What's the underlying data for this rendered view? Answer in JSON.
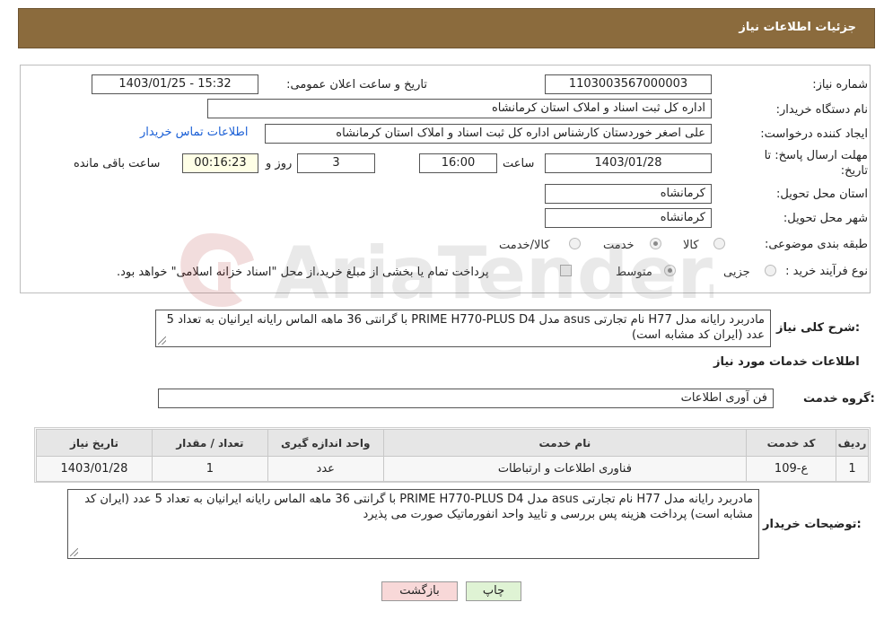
{
  "header": {
    "title": "جزئیات اطلاعات نیاز"
  },
  "form": {
    "need_number_label": "شماره نیاز:",
    "need_number": "1103003567000003",
    "announce_label": "تاریخ و ساعت اعلان عمومی:",
    "announce_value": "1403/01/25 - 15:32",
    "buyer_label": "نام دستگاه خریدار:",
    "buyer_value": "اداره کل ثبت اسناد و املاک استان کرمانشاه",
    "requester_label": "ایجاد کننده درخواست:",
    "requester_value": "علی اصغر خوردستان کارشناس اداره کل ثبت اسناد و املاک استان کرمانشاه",
    "contact_link": "اطلاعات تماس خریدار",
    "deadline_label_1": "مهلت ارسال پاسخ: تا",
    "deadline_label_2": "تاریخ:",
    "deadline_date": "1403/01/28",
    "time_label": "ساعت",
    "deadline_time": "16:00",
    "days_value": "3",
    "days_label": "روز و",
    "remaining_time": "00:16:23",
    "remaining_label": "ساعت باقی مانده",
    "province_label": "استان محل تحویل:",
    "province_value": "کرمانشاه",
    "city_label": "شهر محل تحویل:",
    "city_value": "کرمانشاه",
    "category_label": "طبقه بندی موضوعی:",
    "category_options": [
      "کالا",
      "خدمت",
      "کالا/خدمت"
    ],
    "category_selected_index": 1,
    "process_label": "نوع فرآیند خرید :",
    "process_options": [
      "جزیی",
      "متوسط"
    ],
    "process_selected_index": 1,
    "payment_note": "پرداخت تمام یا بخشی از مبلغ خرید،از محل \"اسناد خزانه اسلامی\" خواهد بود."
  },
  "summary": {
    "label": "شرح کلی نیاز:",
    "text": "مادربرد رایانه مدل H77 نام تجارتی asus مدل PRIME H770-PLUS D4 با گرانتی 36 ماهه الماس رایانه ایرانیان به تعداد 5 عدد (ایران کد مشابه است)"
  },
  "services": {
    "section_title": "اطلاعات خدمات مورد نیاز",
    "group_label": "گروه خدمت:",
    "group_value": "فن آوری اطلاعات",
    "table": {
      "headers": [
        "ردیف",
        "کد خدمت",
        "نام خدمت",
        "واحد اندازه گیری",
        "تعداد / مقدار",
        "تاریخ نیاز"
      ],
      "rows": [
        [
          "1",
          "ع-109",
          "فناوری اطلاعات و ارتباطات",
          "عدد",
          "1",
          "1403/01/28"
        ]
      ]
    }
  },
  "buyer_notes": {
    "label": "توضیحات خریدار:",
    "text": "مادربرد رایانه مدل H77 نام تجارتی asus مدل PRIME H770-PLUS D4 با گرانتی 36 ماهه الماس رایانه ایرانیان به تعداد 5 عدد (ایران کد مشابه است) پرداخت هزینه پس بررسی و تایید واحد انفورماتیک صورت می پذیرد"
  },
  "buttons": {
    "print": "چاپ",
    "back": "بازگشت"
  },
  "watermark": {
    "text": "AriaTender.net"
  },
  "colors": {
    "header_bg": "#8b6b3d",
    "link": "#1a5fd6",
    "print_btn": "#dff3d4",
    "back_btn": "#f8d8d8"
  }
}
